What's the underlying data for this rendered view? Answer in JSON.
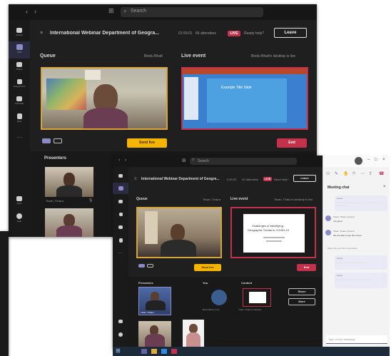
{
  "colors": {
    "brand": "#6264a7",
    "accent_yellow": "#f4b400",
    "record_red": "#c4314b",
    "dark_bg": "#1f1f1f",
    "chat_bg": "#f3f3f3"
  },
  "back_window": {
    "search_placeholder": "Search",
    "rail": [
      {
        "label": "Activity",
        "icon": "bell-icon"
      },
      {
        "label": "Chat",
        "icon": "chat-icon"
      },
      {
        "label": "Teams",
        "icon": "teams-icon"
      },
      {
        "label": "Assignments",
        "icon": "assignments-icon"
      },
      {
        "label": "Calendar",
        "icon": "calendar-icon"
      },
      {
        "label": "Files",
        "icon": "files-icon"
      },
      {
        "label": "Apps",
        "icon": "apps-icon"
      },
      {
        "label": "Help",
        "icon": "help-icon"
      }
    ],
    "meeting_title": "International Webinar Department of Geogra...",
    "timer": "01:59:01",
    "attendees": "66 attendees",
    "live_badge": "LIVE",
    "ready_text": "Ready help?",
    "leave_label": "Leave",
    "queue_label": "Queue",
    "queue_presenter": "Bindu Bhatt",
    "live_event_label": "Live event",
    "live_event_presenter": "Bindu Bhatt's desktop is live",
    "send_live_label": "Send live",
    "end_label": "End",
    "presenters_label": "Presenters",
    "presenter_name": "Tiwari, Thakur",
    "slide_title": "Example Title Slide"
  },
  "front_window": {
    "search_placeholder": "Search",
    "meeting_title": "International Webinar Department of Geogra...",
    "timer": "0:49:23",
    "attendees": "42 attendees",
    "live_badge": "LIVE",
    "ready_text": "Need help?",
    "leave_label": "Leave",
    "queue_label": "Queue",
    "queue_presenter": "Tiwari, Thakur",
    "live_event_label": "Live event",
    "live_event_presenter": "Tiwari, Thakur's desktop is live",
    "slide_line1": "Challenges of Identifying",
    "slide_line2": "Geographic Trends in COVID-19",
    "send_live_label": "Send live",
    "end_label": "End",
    "presenters_label": "Presenters",
    "you_label": "You",
    "content_label": "Content",
    "presenter_name": "Tiwari, Thakur",
    "you_name": "Bindu Bhatt (You)",
    "content_name": "Tiwari, Thakur's desktop",
    "share_label": "Share",
    "more_label": "More"
  },
  "chat": {
    "title": "Meeting chat",
    "messages": [
      {
        "author": "Guest",
        "text": "Thank you. Will these sessions be recorded and shared later?"
      },
      {
        "author": "Tiwari, Thakur (Guest)",
        "text": "Yes great"
      },
      {
        "author": "Tiwari, Thakur (Guest)",
        "text": "We are able to see the screen"
      },
      {
        "author": "",
        "text": "Make this your live presentation"
      },
      {
        "author": "Guest",
        "text": "Thank you for joining everyone"
      },
      {
        "author": "Guest",
        "text": "Thank you. Please check your screen"
      }
    ],
    "compose_placeholder": "Type a new message"
  }
}
